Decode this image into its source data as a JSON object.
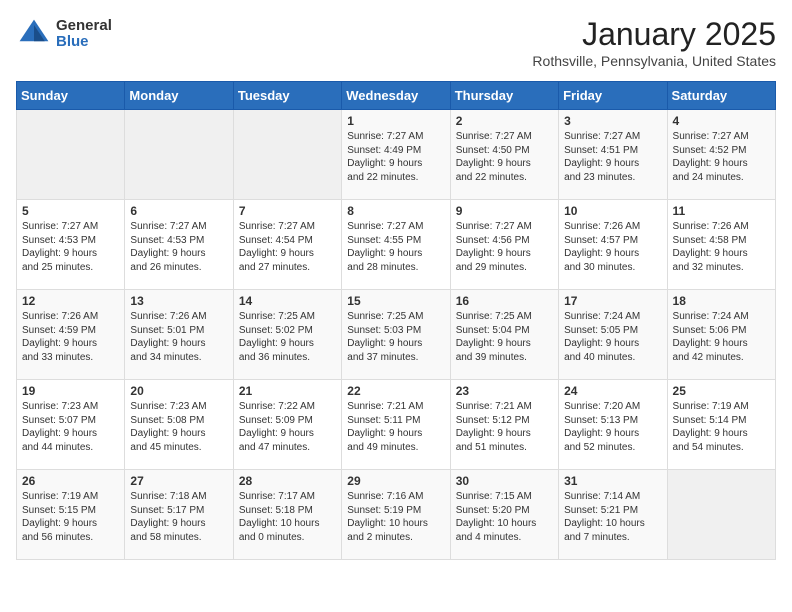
{
  "header": {
    "logo_general": "General",
    "logo_blue": "Blue",
    "month_title": "January 2025",
    "location": "Rothsville, Pennsylvania, United States"
  },
  "days_of_week": [
    "Sunday",
    "Monday",
    "Tuesday",
    "Wednesday",
    "Thursday",
    "Friday",
    "Saturday"
  ],
  "weeks": [
    [
      {
        "day": "",
        "info": ""
      },
      {
        "day": "",
        "info": ""
      },
      {
        "day": "",
        "info": ""
      },
      {
        "day": "1",
        "info": "Sunrise: 7:27 AM\nSunset: 4:49 PM\nDaylight: 9 hours\nand 22 minutes."
      },
      {
        "day": "2",
        "info": "Sunrise: 7:27 AM\nSunset: 4:50 PM\nDaylight: 9 hours\nand 22 minutes."
      },
      {
        "day": "3",
        "info": "Sunrise: 7:27 AM\nSunset: 4:51 PM\nDaylight: 9 hours\nand 23 minutes."
      },
      {
        "day": "4",
        "info": "Sunrise: 7:27 AM\nSunset: 4:52 PM\nDaylight: 9 hours\nand 24 minutes."
      }
    ],
    [
      {
        "day": "5",
        "info": "Sunrise: 7:27 AM\nSunset: 4:53 PM\nDaylight: 9 hours\nand 25 minutes."
      },
      {
        "day": "6",
        "info": "Sunrise: 7:27 AM\nSunset: 4:53 PM\nDaylight: 9 hours\nand 26 minutes."
      },
      {
        "day": "7",
        "info": "Sunrise: 7:27 AM\nSunset: 4:54 PM\nDaylight: 9 hours\nand 27 minutes."
      },
      {
        "day": "8",
        "info": "Sunrise: 7:27 AM\nSunset: 4:55 PM\nDaylight: 9 hours\nand 28 minutes."
      },
      {
        "day": "9",
        "info": "Sunrise: 7:27 AM\nSunset: 4:56 PM\nDaylight: 9 hours\nand 29 minutes."
      },
      {
        "day": "10",
        "info": "Sunrise: 7:26 AM\nSunset: 4:57 PM\nDaylight: 9 hours\nand 30 minutes."
      },
      {
        "day": "11",
        "info": "Sunrise: 7:26 AM\nSunset: 4:58 PM\nDaylight: 9 hours\nand 32 minutes."
      }
    ],
    [
      {
        "day": "12",
        "info": "Sunrise: 7:26 AM\nSunset: 4:59 PM\nDaylight: 9 hours\nand 33 minutes."
      },
      {
        "day": "13",
        "info": "Sunrise: 7:26 AM\nSunset: 5:01 PM\nDaylight: 9 hours\nand 34 minutes."
      },
      {
        "day": "14",
        "info": "Sunrise: 7:25 AM\nSunset: 5:02 PM\nDaylight: 9 hours\nand 36 minutes."
      },
      {
        "day": "15",
        "info": "Sunrise: 7:25 AM\nSunset: 5:03 PM\nDaylight: 9 hours\nand 37 minutes."
      },
      {
        "day": "16",
        "info": "Sunrise: 7:25 AM\nSunset: 5:04 PM\nDaylight: 9 hours\nand 39 minutes."
      },
      {
        "day": "17",
        "info": "Sunrise: 7:24 AM\nSunset: 5:05 PM\nDaylight: 9 hours\nand 40 minutes."
      },
      {
        "day": "18",
        "info": "Sunrise: 7:24 AM\nSunset: 5:06 PM\nDaylight: 9 hours\nand 42 minutes."
      }
    ],
    [
      {
        "day": "19",
        "info": "Sunrise: 7:23 AM\nSunset: 5:07 PM\nDaylight: 9 hours\nand 44 minutes."
      },
      {
        "day": "20",
        "info": "Sunrise: 7:23 AM\nSunset: 5:08 PM\nDaylight: 9 hours\nand 45 minutes."
      },
      {
        "day": "21",
        "info": "Sunrise: 7:22 AM\nSunset: 5:09 PM\nDaylight: 9 hours\nand 47 minutes."
      },
      {
        "day": "22",
        "info": "Sunrise: 7:21 AM\nSunset: 5:11 PM\nDaylight: 9 hours\nand 49 minutes."
      },
      {
        "day": "23",
        "info": "Sunrise: 7:21 AM\nSunset: 5:12 PM\nDaylight: 9 hours\nand 51 minutes."
      },
      {
        "day": "24",
        "info": "Sunrise: 7:20 AM\nSunset: 5:13 PM\nDaylight: 9 hours\nand 52 minutes."
      },
      {
        "day": "25",
        "info": "Sunrise: 7:19 AM\nSunset: 5:14 PM\nDaylight: 9 hours\nand 54 minutes."
      }
    ],
    [
      {
        "day": "26",
        "info": "Sunrise: 7:19 AM\nSunset: 5:15 PM\nDaylight: 9 hours\nand 56 minutes."
      },
      {
        "day": "27",
        "info": "Sunrise: 7:18 AM\nSunset: 5:17 PM\nDaylight: 9 hours\nand 58 minutes."
      },
      {
        "day": "28",
        "info": "Sunrise: 7:17 AM\nSunset: 5:18 PM\nDaylight: 10 hours\nand 0 minutes."
      },
      {
        "day": "29",
        "info": "Sunrise: 7:16 AM\nSunset: 5:19 PM\nDaylight: 10 hours\nand 2 minutes."
      },
      {
        "day": "30",
        "info": "Sunrise: 7:15 AM\nSunset: 5:20 PM\nDaylight: 10 hours\nand 4 minutes."
      },
      {
        "day": "31",
        "info": "Sunrise: 7:14 AM\nSunset: 5:21 PM\nDaylight: 10 hours\nand 7 minutes."
      },
      {
        "day": "",
        "info": ""
      }
    ]
  ]
}
